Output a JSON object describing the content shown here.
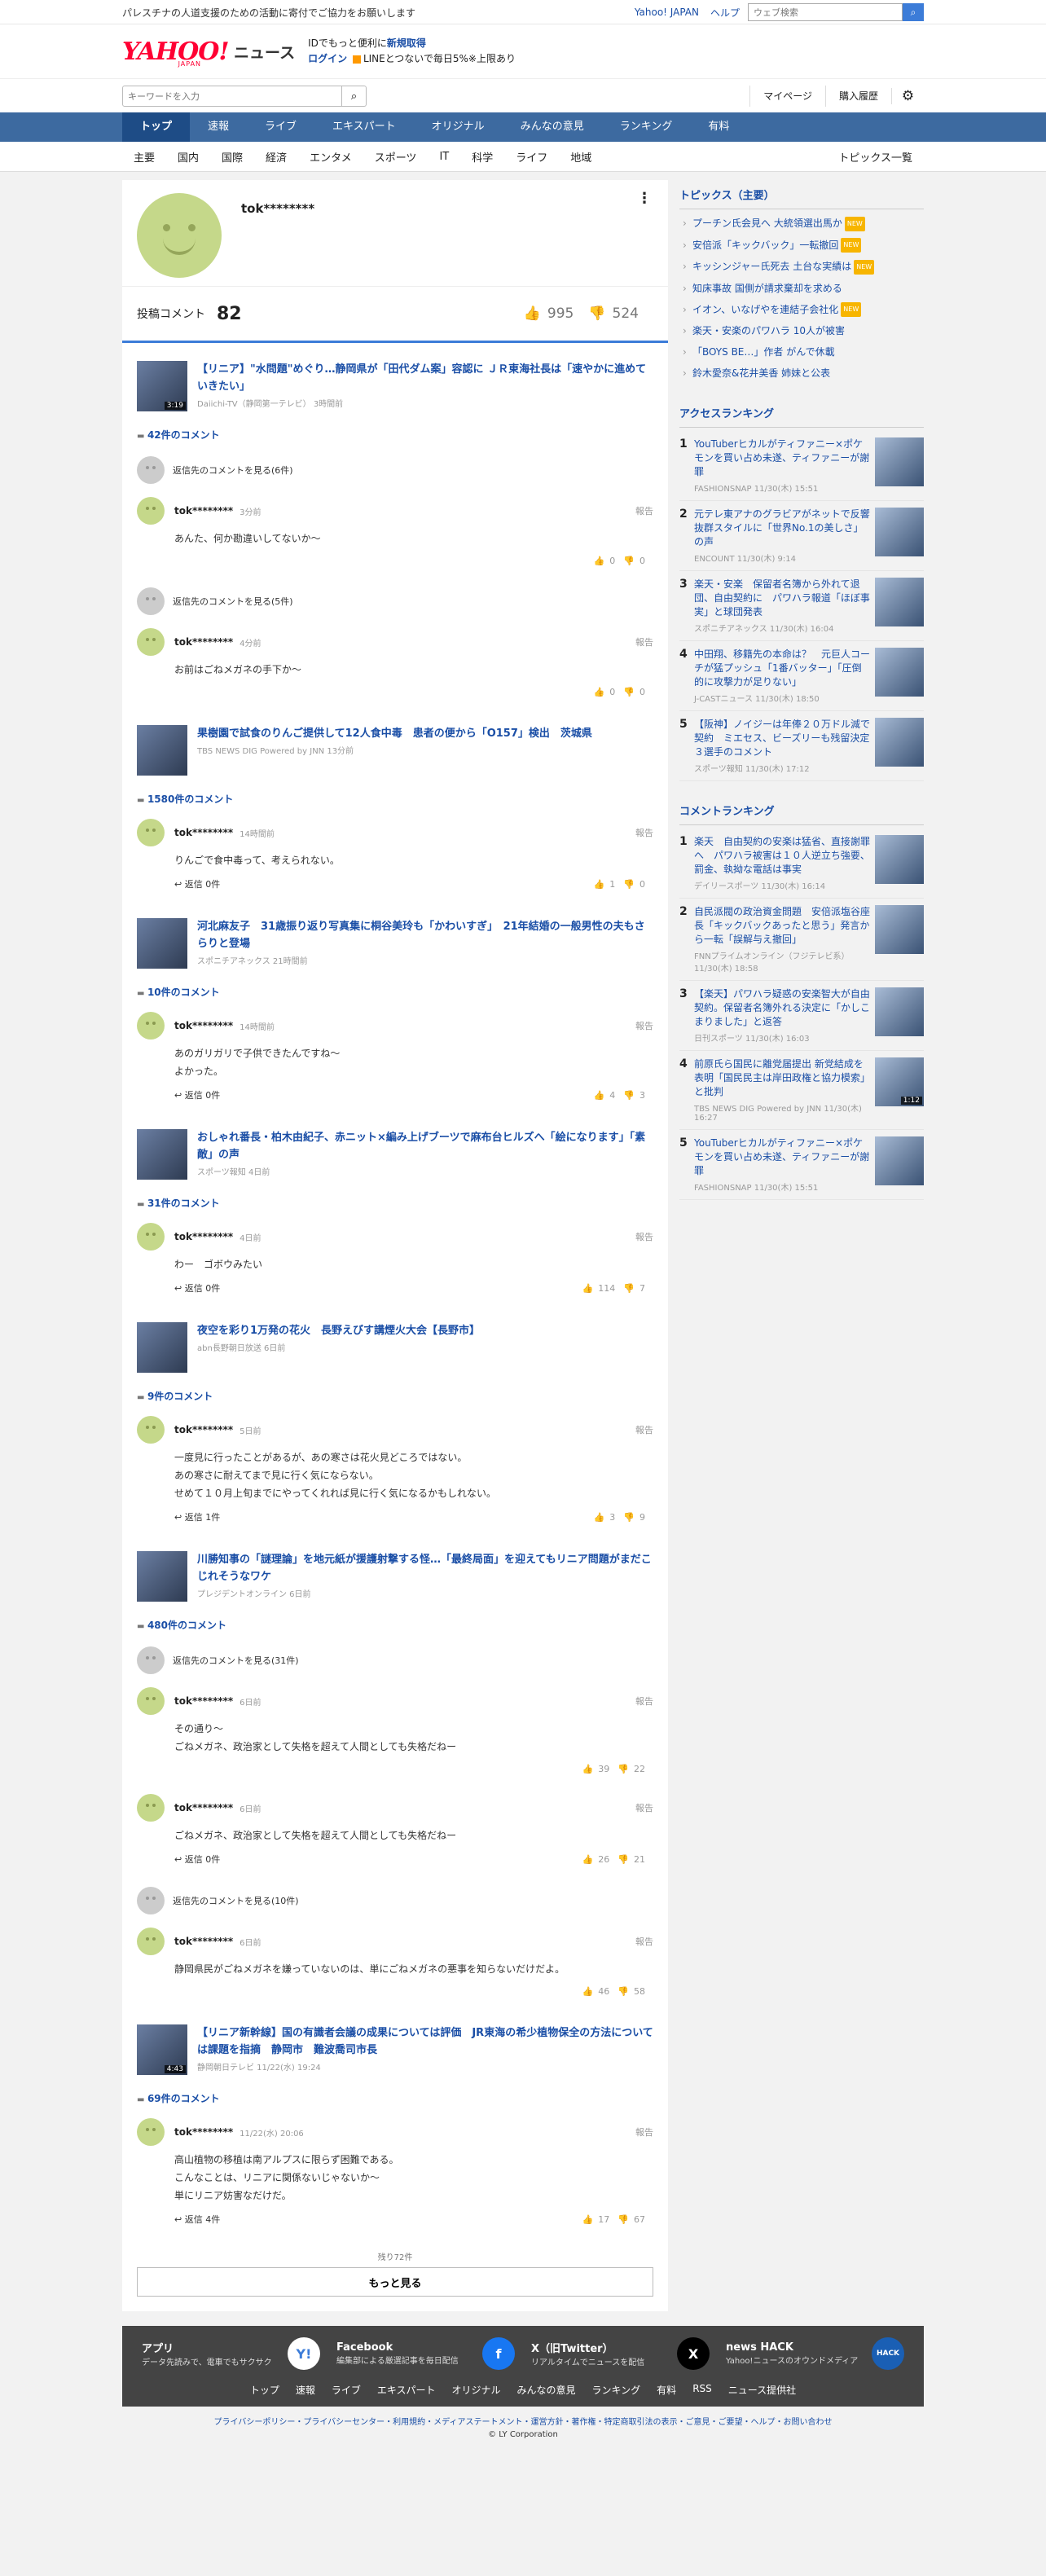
{
  "topbar": {
    "notice": "パレスチナの人道支援のための活動に寄付でご協力をお願いします",
    "yahoo_japan": "Yahoo! JAPAN",
    "help": "ヘルプ",
    "search_placeholder": "ウェブ検索"
  },
  "header": {
    "logo": "YAHOO!",
    "logo_sub": "JAPAN",
    "logo_news": "ニュース",
    "promo_line1_prefix": "IDでもっと便利に",
    "promo_line1_link": "新規取得",
    "promo_login": "ログイン",
    "promo_line2": "LINEとつないで毎日5%",
    "promo_line2_suffix": "※上限あり"
  },
  "search": {
    "placeholder": "キーワードを入力",
    "mypage": "マイページ",
    "history": "購入履歴"
  },
  "gnav": [
    "トップ",
    "速報",
    "ライブ",
    "エキスパート",
    "オリジナル",
    "みんなの意見",
    "ランキング",
    "有料"
  ],
  "snav": [
    "主要",
    "国内",
    "国際",
    "経済",
    "エンタメ",
    "スポーツ",
    "IT",
    "科学",
    "ライフ",
    "地域"
  ],
  "snav_right": "トピックス一覧",
  "profile": {
    "name": "tok********",
    "label": "投稿コメント",
    "count": "82",
    "likes": "995",
    "dislikes": "524"
  },
  "articles": [
    {
      "title": "【リニア】\"水問題\"めぐり…静岡県が「田代ダム案」容認に ＪＲ東海社長は「速やかに進めていきたい」",
      "source": "Daiichi-TV（静岡第一テレビ） 3時間前",
      "dur": "3:19",
      "count": "42件のコメント",
      "items": [
        {
          "kind": "reply",
          "text": "返信先のコメントを見る(6件)"
        },
        {
          "kind": "cmt",
          "name": "tok********",
          "time": "3分前",
          "report": "報告",
          "lines": [
            "あんた、何か勘違いしてないか〜"
          ],
          "reply": "",
          "up": "0",
          "down": "0"
        },
        {
          "kind": "reply",
          "text": "返信先のコメントを見る(5件)"
        },
        {
          "kind": "cmt",
          "name": "tok********",
          "time": "4分前",
          "report": "報告",
          "lines": [
            "お前はごねメガネの手下か〜"
          ],
          "reply": "",
          "up": "0",
          "down": "0"
        }
      ]
    },
    {
      "title": "果樹園で試食のりんご提供して12人食中毒　患者の便から「O157」検出　茨城県",
      "source": "TBS NEWS DIG Powered by JNN 13分前",
      "dur": "",
      "count": "1580件のコメント",
      "items": [
        {
          "kind": "cmt",
          "name": "tok********",
          "time": "14時間前",
          "report": "報告",
          "lines": [
            "りんごで食中毒って、考えられない。"
          ],
          "reply": "返信 0件",
          "up": "1",
          "down": "0"
        }
      ]
    },
    {
      "title": "河北麻友子　31歳振り返り写真集に桐谷美玲も「かわいすぎ」　21年結婚の一般男性の夫もさらりと登場",
      "source": "スポニチアネックス 21時間前",
      "dur": "",
      "count": "10件のコメント",
      "items": [
        {
          "kind": "cmt",
          "name": "tok********",
          "time": "14時間前",
          "report": "報告",
          "lines": [
            "あのガリガリで子供できたんですね〜",
            "よかった。"
          ],
          "reply": "返信 0件",
          "up": "4",
          "down": "3"
        }
      ]
    },
    {
      "title": "おしゃれ番長・柏木由紀子、赤ニット×編み上げブーツで麻布台ヒルズへ「絵になります」「素敵」の声",
      "source": "スポーツ報知 4日前",
      "dur": "",
      "count": "31件のコメント",
      "items": [
        {
          "kind": "cmt",
          "name": "tok********",
          "time": "4日前",
          "report": "報告",
          "lines": [
            "わー　ゴボウみたい"
          ],
          "reply": "返信 0件",
          "up": "114",
          "down": "7"
        }
      ]
    },
    {
      "title": "夜空を彩り1万発の花火　長野えびす講煙火大会【長野市】",
      "source": "abn長野朝日放送 6日前",
      "dur": "",
      "count": "9件のコメント",
      "items": [
        {
          "kind": "cmt",
          "name": "tok********",
          "time": "5日前",
          "report": "報告",
          "lines": [
            "一度見に行ったことがあるが、あの寒さは花火見どころではない。",
            "あの寒さに耐えてまで見に行く気にならない。",
            "せめて１０月上旬までにやってくれれば見に行く気になるかもしれない。"
          ],
          "reply": "返信 1件",
          "up": "3",
          "down": "9"
        }
      ]
    },
    {
      "title": "川勝知事の「謎理論」を地元紙が援護射撃する怪…「最終局面」を迎えてもリニア問題がまだこじれそうなワケ",
      "source": "プレジデントオンライン 6日前",
      "dur": "",
      "count": "480件のコメント",
      "items": [
        {
          "kind": "reply",
          "text": "返信先のコメントを見る(31件)"
        },
        {
          "kind": "cmt",
          "name": "tok********",
          "time": "6日前",
          "report": "報告",
          "lines": [
            "その通り〜",
            "ごねメガネ、政治家として失格を超えて人間としても失格だねー"
          ],
          "reply": "",
          "up": "39",
          "down": "22"
        },
        {
          "kind": "cmt",
          "name": "tok********",
          "time": "6日前",
          "report": "報告",
          "lines": [
            "ごねメガネ、政治家として失格を超えて人間としても失格だねー"
          ],
          "reply": "返信 0件",
          "up": "26",
          "down": "21"
        },
        {
          "kind": "reply",
          "text": "返信先のコメントを見る(10件)"
        },
        {
          "kind": "cmt",
          "name": "tok********",
          "time": "6日前",
          "report": "報告",
          "lines": [
            "静岡県民がごねメガネを嫌っていないのは、単にごねメガネの悪事を知らないだけだよ。"
          ],
          "reply": "",
          "up": "46",
          "down": "58"
        }
      ]
    },
    {
      "title": "【リニア新幹線】国の有識者会議の成果については評価　JR東海の希少植物保全の方法については課題を指摘　静岡市　難波喬司市長",
      "source": "静岡朝日テレビ 11/22(水) 19:24",
      "dur": "4:43",
      "count": "69件のコメント",
      "items": [
        {
          "kind": "cmt",
          "name": "tok********",
          "time": "11/22(水) 20:06",
          "report": "報告",
          "lines": [
            "高山植物の移植は南アルプスに限らず困難である。",
            "こんなことは、リニアに関係ないじゃないか〜",
            "単にリニア妨害なだけだ。"
          ],
          "reply": "返信 4件",
          "up": "17",
          "down": "67"
        }
      ]
    }
  ],
  "more": {
    "remaining": "残り72件",
    "button": "もっと見る"
  },
  "topics": {
    "title": "トピックス（主要）",
    "new_label": "NEW",
    "items": [
      {
        "t": "プーチン氏会見へ 大統領選出馬か",
        "n": true
      },
      {
        "t": "安倍派「キックバック」一転撤回",
        "n": true
      },
      {
        "t": "キッシンジャー氏死去 土台な実績は",
        "n": true
      },
      {
        "t": "知床事故 国側が請求棄却を求める",
        "n": false
      },
      {
        "t": "イオン、いなげやを連結子会社化",
        "n": true
      },
      {
        "t": "楽天・安楽のパワハラ 10人が被害",
        "n": false
      },
      {
        "t": "「BOYS BE…」作者 がんで休載",
        "n": false
      },
      {
        "t": "鈴木愛奈&花井美香 姉妹と公表",
        "n": false
      }
    ]
  },
  "access_ranking": {
    "title": "アクセスランキング",
    "items": [
      {
        "no": "1",
        "t": "YouTuberヒカルがティファニー×ポケモンを買い占め未遂、ティファニーが謝罪",
        "s": "FASHIONSNAP 11/30(木) 15:51",
        "dur": ""
      },
      {
        "no": "2",
        "t": "元テレ東アナのグラビアがネットで反響　抜群スタイルに「世界No.1の美しさ」の声",
        "s": "ENCOUNT 11/30(木) 9:14",
        "dur": ""
      },
      {
        "no": "3",
        "t": "楽天・安楽　保留者名簿から外れて退団、自由契約に　パワハラ報道「ほぼ事実」と球団発表",
        "s": "スポニチアネックス 11/30(木) 16:04",
        "dur": ""
      },
      {
        "no": "4",
        "t": "中田翔、移籍先の本命は？　元巨人コーチが猛プッシュ「1番バッター」「圧倒的に攻撃力が足りない」",
        "s": "J-CASTニュース 11/30(木) 18:50",
        "dur": ""
      },
      {
        "no": "5",
        "t": "【阪神】ノイジーは年俸２０万ドル減で契約　ミエセス、ビーズリーも残留決定　３選手のコメント",
        "s": "スポーツ報知 11/30(木) 17:12",
        "dur": ""
      }
    ]
  },
  "comment_ranking": {
    "title": "コメントランキング",
    "items": [
      {
        "no": "1",
        "t": "楽天　自由契約の安楽は猛省、直接謝罪へ　パワハラ被害は１０人逆立ち強要、罰金、執拗な電話は事実",
        "s": "デイリースポーツ 11/30(木) 16:14",
        "dur": ""
      },
      {
        "no": "2",
        "t": "自民派閥の政治資金問題　安倍派塩谷座長「キックバックあったと思う」発言から一転「誤解与え撤回」",
        "s": "FNNプライムオンライン（フジテレビ系） 11/30(木) 18:58",
        "dur": ""
      },
      {
        "no": "3",
        "t": "【楽天】パワハラ疑惑の安楽智大が自由契約。保留者名簿外れる決定に「かしこまりました」と返答",
        "s": "日刊スポーツ 11/30(木) 16:03",
        "dur": ""
      },
      {
        "no": "4",
        "t": "前原氏ら国民に離党届提出 新党結成を表明「国民民主は岸田政権と協力模索」と批判",
        "s": "TBS NEWS DIG Powered by JNN 11/30(木) 16:27",
        "dur": "1:12"
      },
      {
        "no": "5",
        "t": "YouTuberヒカルがティファニー×ポケモンを買い占め未遂、ティファニーが謝罪",
        "s": "FASHIONSNAP 11/30(木) 15:51",
        "dur": ""
      }
    ]
  },
  "footer": {
    "apps": [
      {
        "h": "アプリ",
        "d": "データ先読みで、電車でもサクサク",
        "icon": "Y!"
      },
      {
        "h": "Facebook",
        "d": "編集部による厳選記事を毎日配信",
        "icon": "f"
      },
      {
        "h": "X（旧Twitter）",
        "d": "リアルタイムでニュースを配信",
        "icon": "X"
      },
      {
        "h": "news HACK",
        "d": "Yahoo!ニュースのオウンドメディア",
        "icon": "HACK"
      }
    ],
    "nav": [
      "トップ",
      "速報",
      "ライブ",
      "エキスパート",
      "オリジナル",
      "みんなの意見",
      "ランキング",
      "有料",
      "RSS",
      "ニュース提供社"
    ],
    "legal": "プライバシーポリシー・プライバシーセンター・利用規約・メディアステートメント・運営方針・著作権・特定商取引法の表示・ご意見・ご要望・ヘルプ・お問い合わせ",
    "copy": "© LY Corporation"
  },
  "colors": {
    "brand": "#ff0033",
    "nav": "#3d6aa0",
    "link": "#1a4ea6",
    "accent": "#3c7cd8"
  }
}
